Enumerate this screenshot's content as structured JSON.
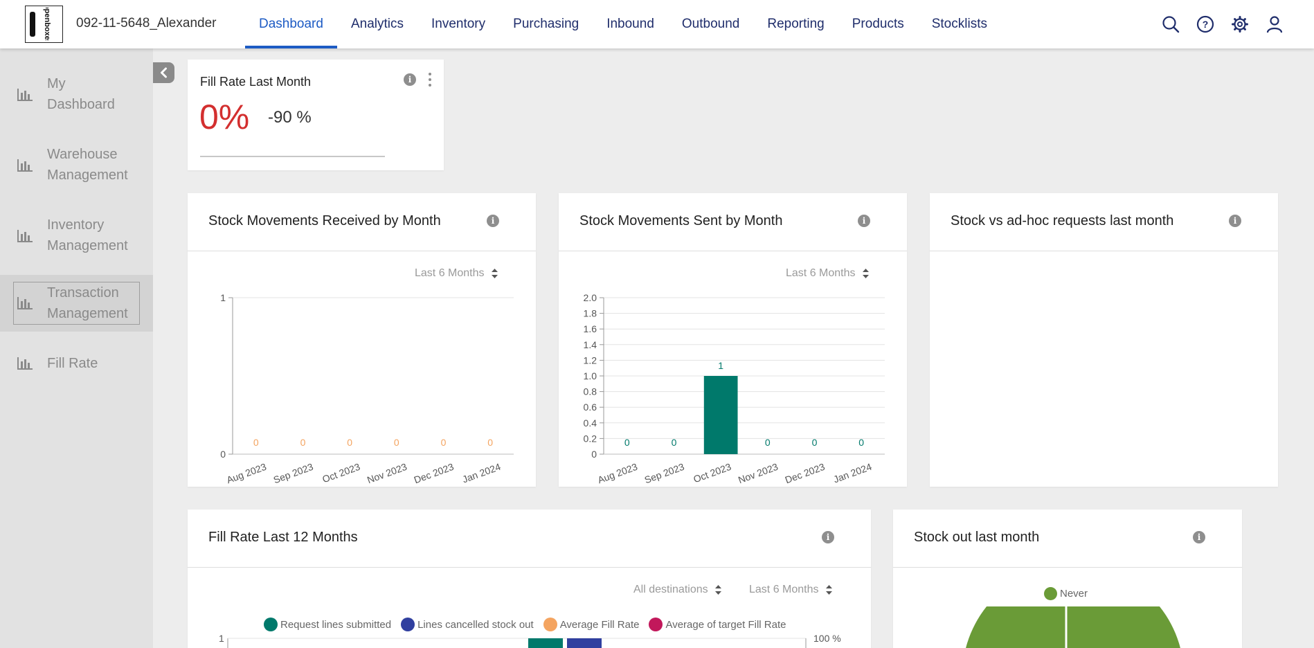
{
  "header": {
    "location": "092-11-5648_Alexander",
    "nav": [
      {
        "label": "Dashboard",
        "active": true
      },
      {
        "label": "Analytics"
      },
      {
        "label": "Inventory"
      },
      {
        "label": "Purchasing"
      },
      {
        "label": "Inbound"
      },
      {
        "label": "Outbound"
      },
      {
        "label": "Reporting"
      },
      {
        "label": "Products"
      },
      {
        "label": "Stocklists"
      }
    ],
    "icons": [
      "search-icon",
      "help-icon",
      "settings-icon",
      "user-icon"
    ]
  },
  "sidebar": {
    "items": [
      {
        "line1": "My",
        "line2": "Dashboard"
      },
      {
        "line1": "Warehouse",
        "line2": "Management"
      },
      {
        "line1": "Inventory",
        "line2": "Management"
      },
      {
        "line1": "Transaction",
        "line2": "Management",
        "active": true
      },
      {
        "line1": "Fill Rate",
        "line2": ""
      }
    ]
  },
  "fill_rate_tile": {
    "title": "Fill Rate Last Month",
    "value": "0%",
    "delta": "-90 %",
    "value_color": "#d32f2f"
  },
  "cards": {
    "received": {
      "title": "Stock Movements Received by Month",
      "filter": "Last 6 Months"
    },
    "sent": {
      "title": "Stock Movements Sent by Month",
      "filter": "Last 6 Months"
    },
    "adhoc": {
      "title": "Stock vs ad-hoc requests last month"
    },
    "fill12": {
      "title": "Fill Rate Last 12 Months",
      "filter_dest": "All destinations",
      "filter_period": "Last 6 Months",
      "right_axis_top": "100 %",
      "left_axis_top": "1"
    },
    "stockout": {
      "title": "Stock out last month"
    }
  },
  "colors": {
    "teal": "#00796b",
    "navy": "#303f9f",
    "orange": "#f4a460",
    "crimson": "#c2185b",
    "green": "#6a9b37",
    "accent": "#1d5bc4"
  },
  "chart_data": [
    {
      "type": "bar",
      "title": "Stock Movements Received by Month",
      "categories": [
        "Aug 2023",
        "Sep 2023",
        "Oct 2023",
        "Nov 2023",
        "Dec 2023",
        "Jan 2024"
      ],
      "values": [
        0,
        0,
        0,
        0,
        0,
        0
      ],
      "yticks": [
        "0",
        "1"
      ],
      "ylim": [
        0,
        1
      ],
      "color": "#f4a460"
    },
    {
      "type": "bar",
      "title": "Stock Movements Sent by Month",
      "categories": [
        "Aug 2023",
        "Sep 2023",
        "Oct 2023",
        "Nov 2023",
        "Dec 2023",
        "Jan 2024"
      ],
      "values": [
        0,
        0,
        1,
        0,
        0,
        0
      ],
      "yticks": [
        "0",
        "0.2",
        "0.4",
        "0.6",
        "0.8",
        "1.0",
        "1.2",
        "1.4",
        "1.6",
        "1.8",
        "2.0"
      ],
      "ylim": [
        0,
        2
      ],
      "color": "#00796b"
    },
    {
      "type": "bar",
      "title": "Fill Rate Last 12 Months",
      "series": [
        {
          "name": "Request lines submitted",
          "color": "#00796b"
        },
        {
          "name": "Lines cancelled stock out",
          "color": "#303f9f"
        },
        {
          "name": "Average Fill Rate",
          "color": "#f4a460"
        },
        {
          "name": "Average of target Fill Rate",
          "color": "#c2185b"
        }
      ]
    },
    {
      "type": "pie",
      "title": "Stock out last month",
      "legend": [
        {
          "name": "Never",
          "color": "#6a9b37"
        }
      ]
    }
  ]
}
